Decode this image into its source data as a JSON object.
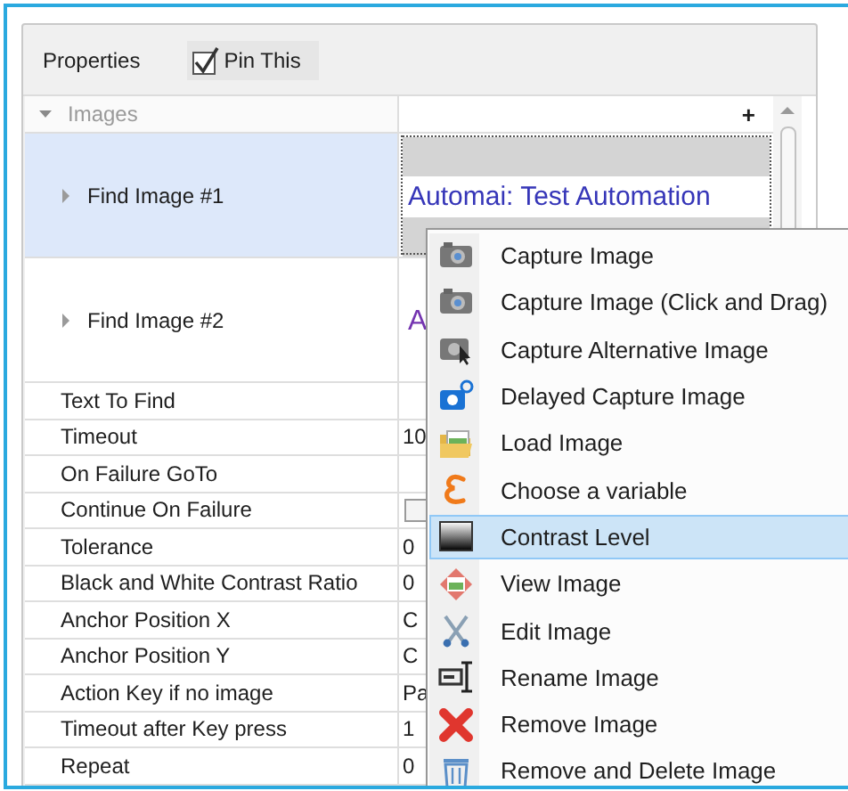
{
  "header": {
    "title": "Properties",
    "pin": {
      "label": "Pin This",
      "checked": true
    }
  },
  "grid": {
    "category": {
      "label": "Images",
      "expanded": true,
      "action": "+"
    },
    "rows": [
      {
        "kind": "image",
        "label": "Find Image #1",
        "value": "Automai: Test Automation",
        "selected": true,
        "expanded": false
      },
      {
        "kind": "image",
        "label": "Find Image #2",
        "value": "A",
        "selected": false,
        "expanded": false
      },
      {
        "kind": "text",
        "label": "Text To Find",
        "selected": false
      },
      {
        "kind": "text",
        "label": "Timeout",
        "value": "10",
        "selected": false
      },
      {
        "kind": "text",
        "label": "On Failure GoTo",
        "selected": false
      },
      {
        "kind": "checkbox",
        "label": "Continue On Failure",
        "checked": false,
        "selected": false
      },
      {
        "kind": "text",
        "label": "Tolerance",
        "value": "0",
        "selected": false
      },
      {
        "kind": "text",
        "label": "Black and White Contrast Ratio",
        "value": "0",
        "selected": false
      },
      {
        "kind": "text",
        "label": "Anchor Position X",
        "value": "C",
        "selected": false
      },
      {
        "kind": "text",
        "label": "Anchor Position Y",
        "value": "C",
        "selected": false
      },
      {
        "kind": "text",
        "label": "Action Key if no image",
        "value": "Pa",
        "selected": false
      },
      {
        "kind": "text",
        "label": "Timeout after Key press",
        "value": "1",
        "selected": false
      },
      {
        "kind": "text",
        "label": "Repeat",
        "value": "0",
        "selected": false
      }
    ]
  },
  "context_menu": {
    "items": [
      {
        "label": "Capture Image",
        "selected": false
      },
      {
        "label": "Capture Image (Click and Drag)",
        "selected": false
      },
      {
        "label": "Capture Alternative Image",
        "selected": false
      },
      {
        "label": "Delayed Capture Image",
        "selected": false
      },
      {
        "label": "Load Image",
        "selected": false
      },
      {
        "label": "Choose a variable",
        "selected": false
      },
      {
        "label": "Contrast Level",
        "selected": true
      },
      {
        "label": "View Image",
        "selected": false
      },
      {
        "label": "Edit Image",
        "selected": false
      },
      {
        "label": "Rename Image",
        "selected": false
      },
      {
        "label": "Remove Image",
        "selected": false
      },
      {
        "label": "Remove and Delete Image",
        "selected": false
      }
    ]
  }
}
